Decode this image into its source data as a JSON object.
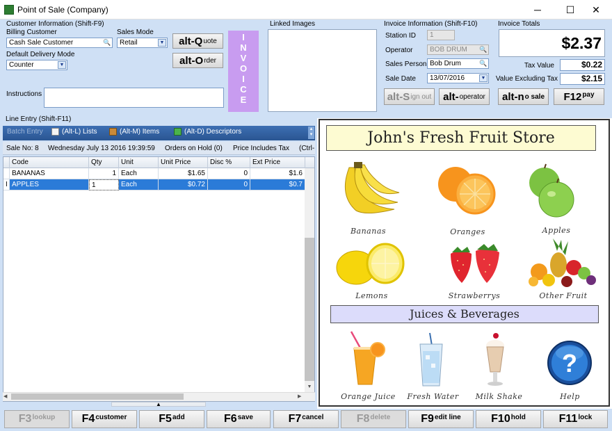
{
  "window": {
    "title": "Point of Sale (Company)",
    "minimize": "─",
    "maximize": "☐",
    "close": "✕"
  },
  "customer": {
    "group_label": "Customer Information (Shift-F9)",
    "billing_label": "Billing Customer",
    "billing_value": "Cash Sale Customer",
    "sales_mode_label": "Sales Mode",
    "sales_mode_value": "Retail",
    "delivery_label": "Default Delivery Mode",
    "delivery_value": "Counter",
    "instructions_label": "Instructions",
    "instructions_value": ""
  },
  "quote_button": {
    "key": "alt-Q",
    "label": "uote"
  },
  "order_button": {
    "key": "alt-O",
    "label": "rder"
  },
  "invoice_bar": {
    "letters": [
      "I",
      "N",
      "V",
      "O",
      "I",
      "C",
      "E"
    ]
  },
  "linked_images": {
    "label": "Linked Images"
  },
  "invoice_info": {
    "group_label": "Invoice Information (Shift-F10)",
    "station_label": "Station ID",
    "station_value": "1",
    "operator_label": "Operator",
    "operator_value": "BOB DRUM",
    "salesperson_label": "Sales Person",
    "salesperson_value": "Bob Drum",
    "date_label": "Sale Date",
    "date_value": "13/07/2016",
    "signout_key": "alt-S",
    "signout_label": "ign out",
    "operator_btn_key": "alt-",
    "operator_btn_label": "operator"
  },
  "totals": {
    "group_label": "Invoice Totals",
    "total": "$2.37",
    "tax_label": "Tax Value",
    "tax_value": "$0.22",
    "excl_label": "Value Excluding Tax",
    "excl_value": "$2.15",
    "nosale_key": "alt-n",
    "nosale_label": "o sale",
    "pay_key": "F12",
    "pay_label": "pay"
  },
  "line_entry": {
    "label": "Line Entry (Shift-F11)",
    "toolbar": {
      "batch": "Batch Entry",
      "lists": "(Alt-L) Lists",
      "items": "(Alt-M) Items",
      "descriptors": "(Alt-D) Descriptors"
    },
    "info": {
      "sale_no": "Sale No: 8",
      "date": "Wednesday  July 13  2016  19:39:59",
      "hold": "Orders on Hold (0)",
      "price_tax": "Price Includes Tax",
      "ctrl": "(Ctrl-"
    },
    "columns": [
      "Code",
      "Qty",
      "Unit",
      "Unit Price",
      "Disc %",
      "Ext Price"
    ],
    "rows": [
      {
        "code": "BANANAS",
        "qty": "1",
        "unit": "Each",
        "unit_price": "$1.65",
        "disc": "0",
        "ext": "$1.6"
      },
      {
        "code": "APPLES",
        "qty": "1",
        "unit": "Each",
        "unit_price": "$0.72",
        "disc": "0",
        "ext": "$0.7"
      }
    ],
    "row_indicator": "I"
  },
  "store": {
    "title": "John's Fresh Fruit Store",
    "juices_title": "Juices & Beverages",
    "products": [
      "Bananas",
      "Oranges",
      "Apples",
      "Lemons",
      "Strawberrys",
      "Other Fruit"
    ],
    "beverages": [
      "Orange Juice",
      "Fresh Water",
      "Milk Shake",
      "Help"
    ]
  },
  "fkeys": [
    {
      "key": "F3",
      "label": "lookup",
      "disabled": true
    },
    {
      "key": "F4",
      "label": "customer",
      "disabled": false
    },
    {
      "key": "F5",
      "label": "add",
      "disabled": false
    },
    {
      "key": "F6",
      "label": "save",
      "disabled": false
    },
    {
      "key": "F7",
      "label": "cancel",
      "disabled": false
    },
    {
      "key": "F8",
      "label": "delete",
      "disabled": true
    },
    {
      "key": "F9",
      "label": "edit line",
      "disabled": false
    },
    {
      "key": "F10",
      "label": "hold",
      "disabled": false
    },
    {
      "key": "F11",
      "label": "lock",
      "disabled": false
    }
  ]
}
